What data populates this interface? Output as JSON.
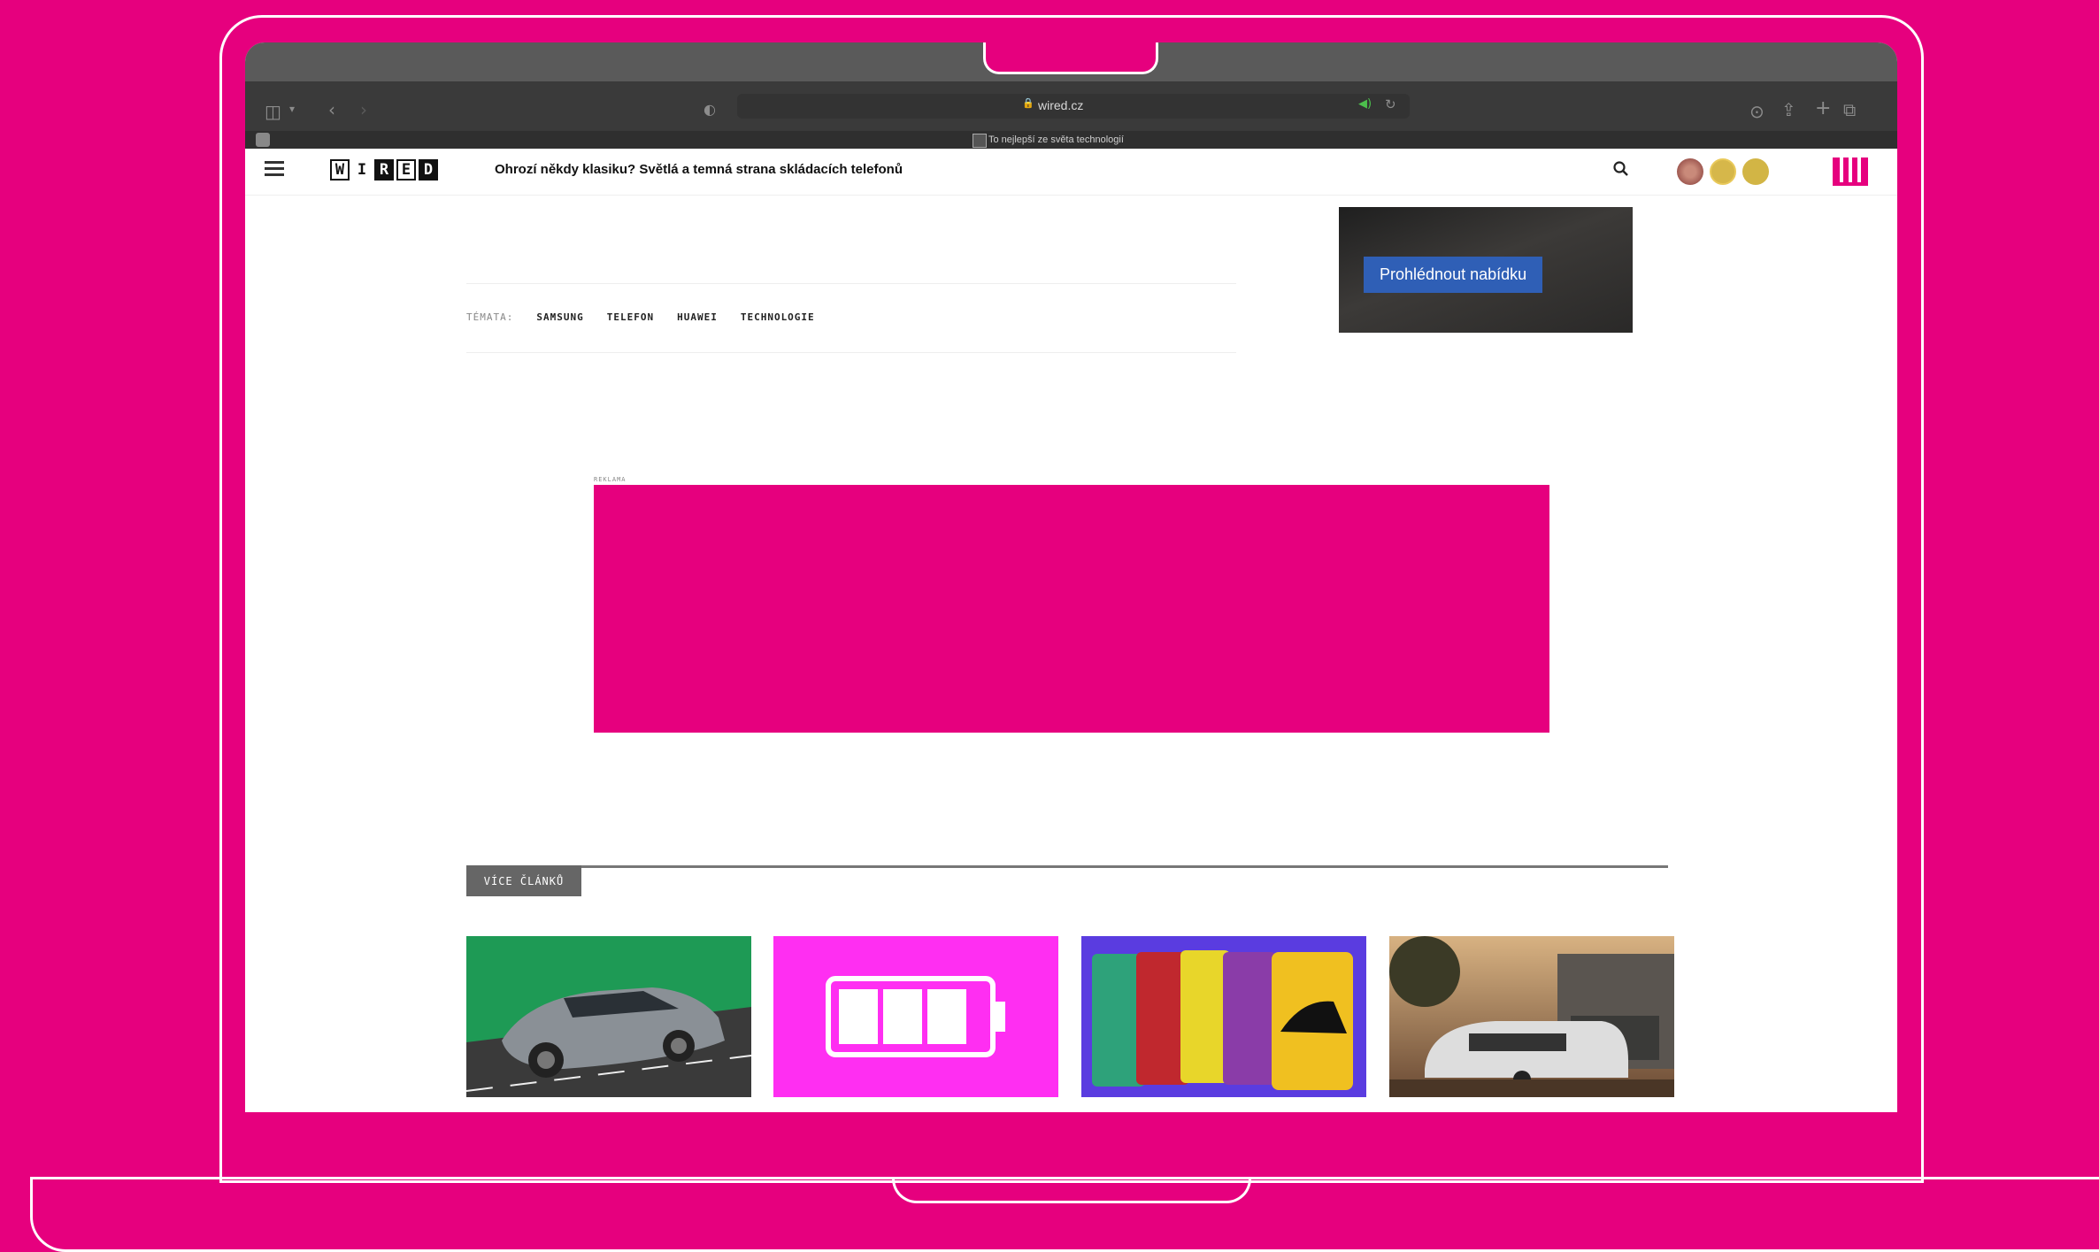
{
  "browser": {
    "url": "wired.cz",
    "tab_title": "To nejlepší ze světa technologií"
  },
  "site": {
    "article_title": "Ohrozí někdy klasiku? Světlá a temná strana skládacích telefonů",
    "logo_letters": [
      "W",
      "I",
      "R",
      "E",
      "D"
    ]
  },
  "ad": {
    "button_label": "Prohlédnout nabídku"
  },
  "tags": {
    "label": "TÉMATA:",
    "items": [
      "SAMSUNG",
      "TELEFON",
      "HUAWEI",
      "TECHNOLOGIE"
    ]
  },
  "reklama": {
    "label": "REKLAMA"
  },
  "more": {
    "label": "VÍCE ČLÁNKŮ"
  },
  "colors": {
    "brand_magenta": "#e6007e",
    "ad_button_blue": "#2f5fb6"
  }
}
